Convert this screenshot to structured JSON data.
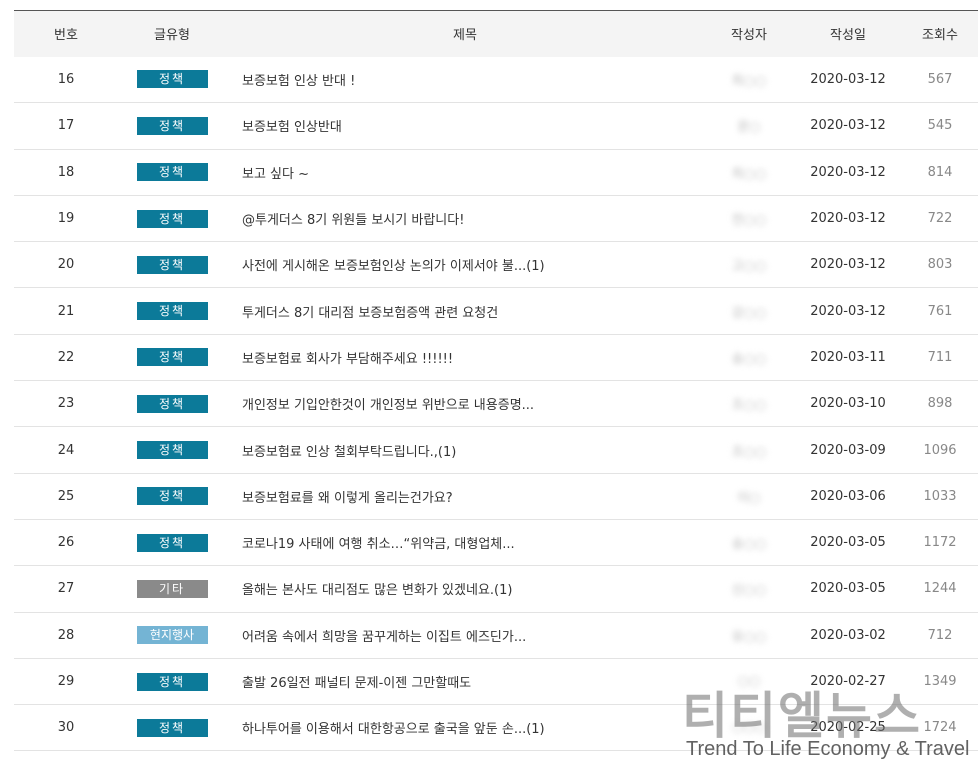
{
  "headers": {
    "no": "번호",
    "category": "글유형",
    "title": "제목",
    "author": "작성자",
    "date": "작성일",
    "views": "조회수"
  },
  "colors": {
    "policy": "#0c7a99",
    "etc": "#8a8a8a",
    "local": "#74b4d4"
  },
  "rows": [
    {
      "no": "16",
      "category": "정책",
      "title": "보증보험 인상 반대 !",
      "author": "최○○",
      "date": "2020-03-12",
      "views": "567"
    },
    {
      "no": "17",
      "category": "정책",
      "title": "보증보험 인상반대",
      "author": "문○",
      "date": "2020-03-12",
      "views": "545"
    },
    {
      "no": "18",
      "category": "정책",
      "title": "보고 싶다 ~",
      "author": "최○○",
      "date": "2020-03-12",
      "views": "814"
    },
    {
      "no": "19",
      "category": "정책",
      "title": "@투게더스 8기 위원들 보시기 바랍니다!",
      "author": "전○○",
      "date": "2020-03-12",
      "views": "722"
    },
    {
      "no": "20",
      "category": "정책",
      "title": "사전에 게시해온 보증보험인상 논의가 이제서야 불...(1)",
      "author": "고○○",
      "date": "2020-03-12",
      "views": "803"
    },
    {
      "no": "21",
      "category": "정책",
      "title": "투게더스 8기 대리점 보증보험증액 관련 요청건",
      "author": "강○○",
      "date": "2020-03-12",
      "views": "761"
    },
    {
      "no": "22",
      "category": "정책",
      "title": "보증보험료 회사가 부담해주세요 !!!!!!",
      "author": "송○○",
      "date": "2020-03-11",
      "views": "711"
    },
    {
      "no": "23",
      "category": "정책",
      "title": "개인정보 기입안한것이 개인정보 위반으로 내용증명...",
      "author": "조○○",
      "date": "2020-03-10",
      "views": "898"
    },
    {
      "no": "24",
      "category": "정책",
      "title": "보증보험료 인상 철회부탁드립니다.,(1)",
      "author": "조○○",
      "date": "2020-03-09",
      "views": "1096"
    },
    {
      "no": "25",
      "category": "정책",
      "title": "보증보험료를 왜 이렇게 올리는건가요?",
      "author": "이○",
      "date": "2020-03-06",
      "views": "1033"
    },
    {
      "no": "26",
      "category": "정책",
      "title": "코로나19 사태에 여행 취소…“위약금, 대형업체...",
      "author": "송○○",
      "date": "2020-03-05",
      "views": "1172"
    },
    {
      "no": "27",
      "category": "기타",
      "title": "올해는 본사도 대리점도 많은 변화가 있겠네요.(1)",
      "author": "신○○",
      "date": "2020-03-05",
      "views": "1244"
    },
    {
      "no": "28",
      "category": "현지행사",
      "title": "어려움 속에서 희망을 꿈꾸게하는 이집트 에즈딘가...",
      "author": "유○○",
      "date": "2020-03-02",
      "views": "712"
    },
    {
      "no": "29",
      "category": "정책",
      "title": "출발 26일전 패널티 문제-이젠 그만할때도",
      "author": "○○",
      "date": "2020-02-27",
      "views": "1349"
    },
    {
      "no": "30",
      "category": "정책",
      "title": "하나투어를 이용해서 대한항공으로 출국을 앞둔 손...(1)",
      "author": "○○○",
      "date": "2020-02-25",
      "views": "1724"
    }
  ],
  "watermark": {
    "logo": "티티엘뉴스",
    "tagline": "Trend To Life Economy & Travel"
  }
}
